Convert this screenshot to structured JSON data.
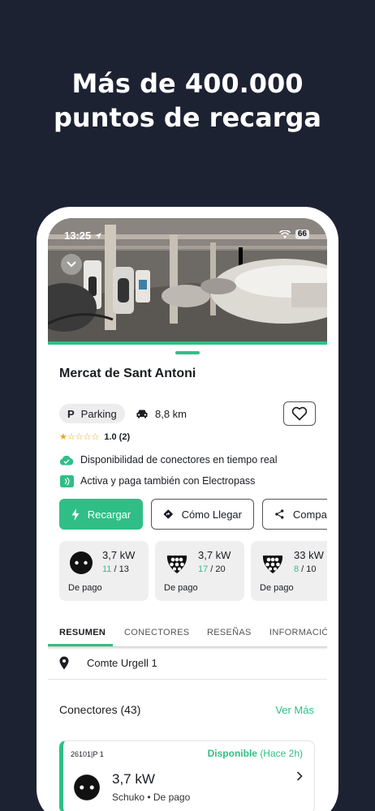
{
  "headline": {
    "line1": "Más de 400.000",
    "line2": "puntos de recarga"
  },
  "status_bar": {
    "time": "13:25",
    "battery": "66"
  },
  "station": {
    "name": "Mercat de Sant Antoni",
    "type_chip": "Parking",
    "type_chip_icon": "P",
    "distance": "8,8 km",
    "stars_filled": "★",
    "stars_empty": "☆☆☆☆",
    "rating": "1.0 (2)",
    "feature_realtime": "Disponibilidad de conectores en tiempo real",
    "feature_electropass": "Activa y paga también con Electropass"
  },
  "actions": {
    "charge": "Recargar",
    "directions": "Cómo Llegar",
    "share": "Compartir"
  },
  "connector_summary": [
    {
      "power": "3,7 kW",
      "available": "11",
      "total": "13",
      "payment": "De pago",
      "plug": "schuko"
    },
    {
      "power": "3,7 kW",
      "available": "17",
      "total": "20",
      "payment": "De pago",
      "plug": "type2"
    },
    {
      "power": "33 kW",
      "available": "8",
      "total": "10",
      "payment": "De pago",
      "plug": "type2"
    }
  ],
  "tabs": [
    "RESUMEN",
    "CONECTORES",
    "RESEÑAS",
    "INFORMACIÓN"
  ],
  "active_tab": "RESUMEN",
  "address": "Comte Urgell 1",
  "connectors_section": {
    "title": "Conectores (43)",
    "see_more": "Ver Más"
  },
  "connector_detail": {
    "id": "26101|P 1",
    "status": "Disponible",
    "since": "(Hace 2h)",
    "power": "3,7 kW",
    "description": "Schuko • De pago"
  },
  "colors": {
    "accent": "#2fbf86",
    "background": "#1d2233",
    "rating": "#f0a11b"
  }
}
